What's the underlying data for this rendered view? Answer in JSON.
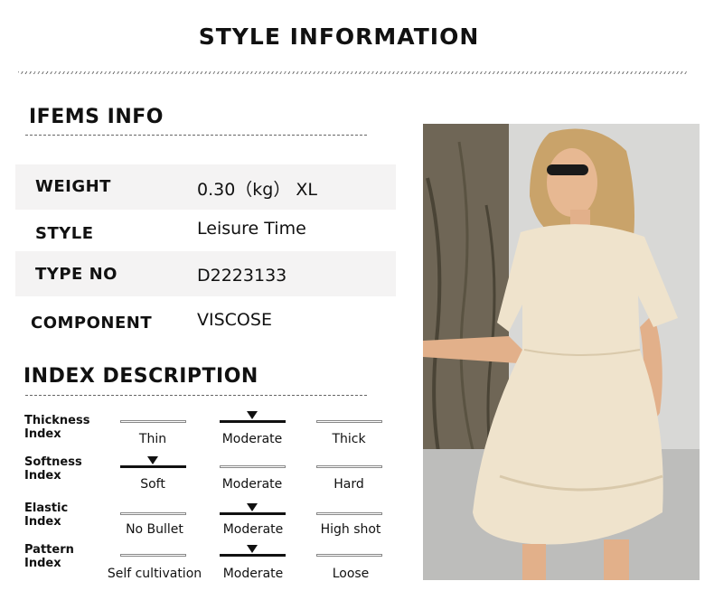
{
  "header": {
    "title": "STYLE INFORMATION"
  },
  "items": {
    "title": "IFEMS INFO",
    "rows": [
      {
        "label": "WEIGHT",
        "value": "0.30（kg） XL"
      },
      {
        "label": "STYLE",
        "value": "Leisure Time"
      },
      {
        "label": "TYPE NO",
        "value": "D2223133"
      },
      {
        "label": "COMPONENT",
        "value": "VISCOSE"
      }
    ]
  },
  "index": {
    "title": "INDEX DESCRIPTION",
    "rows": [
      {
        "label_line1": "Thickness",
        "label_line2": "Index",
        "options": [
          "Thin",
          "Moderate",
          "Thick"
        ],
        "selected_index": 1
      },
      {
        "label_line1": "Softness",
        "label_line2": "Index",
        "options": [
          "Soft",
          "Moderate",
          "Hard"
        ],
        "selected_index": 0
      },
      {
        "label_line1": "Elastic",
        "label_line2": "Index",
        "options": [
          "No Bullet",
          "Moderate",
          "High shot"
        ],
        "selected_index": 1
      },
      {
        "label_line1": "Pattern",
        "label_line2": "Index",
        "options": [
          "Self cultivation",
          "Moderate",
          "Loose"
        ],
        "selected_index": 1
      }
    ]
  },
  "colors": {
    "row_shade": "#f4f3f3",
    "dress": "#efe3cc",
    "hair": "#c9a36a",
    "wall": "#d8d8d6"
  }
}
